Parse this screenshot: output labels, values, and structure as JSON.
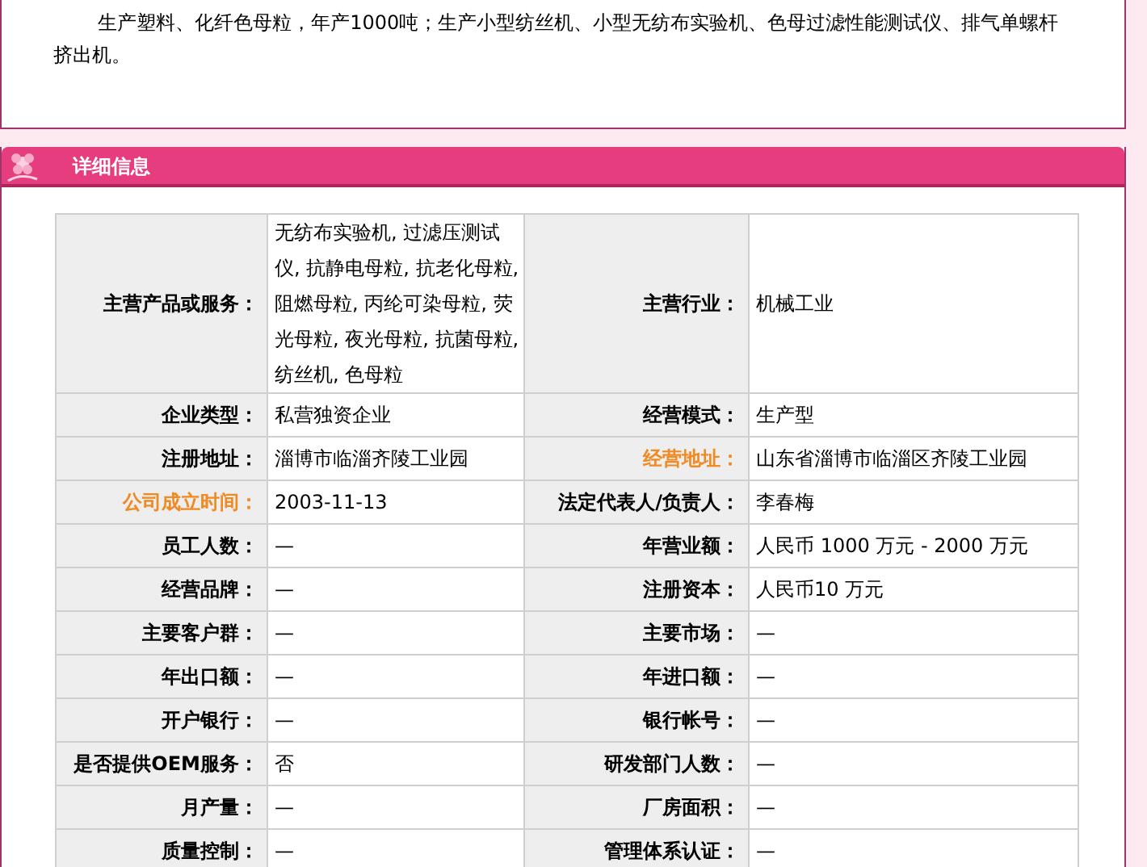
{
  "intro": {
    "text": "生产塑料、化纤色母粒，年产1000吨；生产小型纺丝机、小型无纺布实验机、色母过滤性能测试仪、排气单螺杆挤出机。"
  },
  "section": {
    "title": "详细信息"
  },
  "rows": [
    {
      "cells": [
        {
          "label": "主营产品或服务：",
          "highlighted": false,
          "value": "无纺布实验机, 过滤压测试仪, 抗静电母粒, 抗老化母粒, 阻燃母粒, 丙纶可染母粒, 荧光母粒, 夜光母粒, 抗菌母粒, 纺丝机, 色母粒"
        },
        {
          "label": "主营行业：",
          "highlighted": false,
          "value": "机械工业"
        }
      ]
    },
    {
      "cells": [
        {
          "label": "企业类型：",
          "highlighted": false,
          "value": "私营独资企业"
        },
        {
          "label": "经营模式：",
          "highlighted": false,
          "value": "生产型"
        }
      ]
    },
    {
      "cells": [
        {
          "label": "注册地址：",
          "highlighted": false,
          "value": "淄博市临淄齐陵工业园"
        },
        {
          "label": "经营地址：",
          "highlighted": true,
          "value": "山东省淄博市临淄区齐陵工业园"
        }
      ]
    },
    {
      "cells": [
        {
          "label": "公司成立时间：",
          "highlighted": true,
          "value": "2003-11-13"
        },
        {
          "label": "法定代表人/负责人：",
          "highlighted": false,
          "value": "李春梅"
        }
      ]
    },
    {
      "cells": [
        {
          "label": "员工人数：",
          "highlighted": false,
          "value": "—"
        },
        {
          "label": "年营业额：",
          "highlighted": false,
          "value": "人民币 1000 万元 - 2000 万元"
        }
      ]
    },
    {
      "cells": [
        {
          "label": "经营品牌：",
          "highlighted": false,
          "value": "—"
        },
        {
          "label": "注册资本：",
          "highlighted": false,
          "value": "人民币10 万元"
        }
      ]
    },
    {
      "cells": [
        {
          "label": "主要客户群：",
          "highlighted": false,
          "value": "—"
        },
        {
          "label": "主要市场：",
          "highlighted": false,
          "value": "—"
        }
      ]
    },
    {
      "cells": [
        {
          "label": "年出口额：",
          "highlighted": false,
          "value": "—"
        },
        {
          "label": "年进口额：",
          "highlighted": false,
          "value": "—"
        }
      ]
    },
    {
      "cells": [
        {
          "label": "开户银行：",
          "highlighted": false,
          "value": "—"
        },
        {
          "label": "银行帐号：",
          "highlighted": false,
          "value": "—"
        }
      ]
    },
    {
      "cells": [
        {
          "label": "是否提供OEM服务：",
          "highlighted": false,
          "value": "否"
        },
        {
          "label": "研发部门人数：",
          "highlighted": false,
          "value": "—"
        }
      ]
    },
    {
      "cells": [
        {
          "label": "月产量：",
          "highlighted": false,
          "value": "—"
        },
        {
          "label": "厂房面积：",
          "highlighted": false,
          "value": "—"
        }
      ]
    },
    {
      "cells": [
        {
          "label": "质量控制：",
          "highlighted": false,
          "value": "—"
        },
        {
          "label": "管理体系认证：",
          "highlighted": false,
          "value": "—"
        }
      ]
    }
  ]
}
